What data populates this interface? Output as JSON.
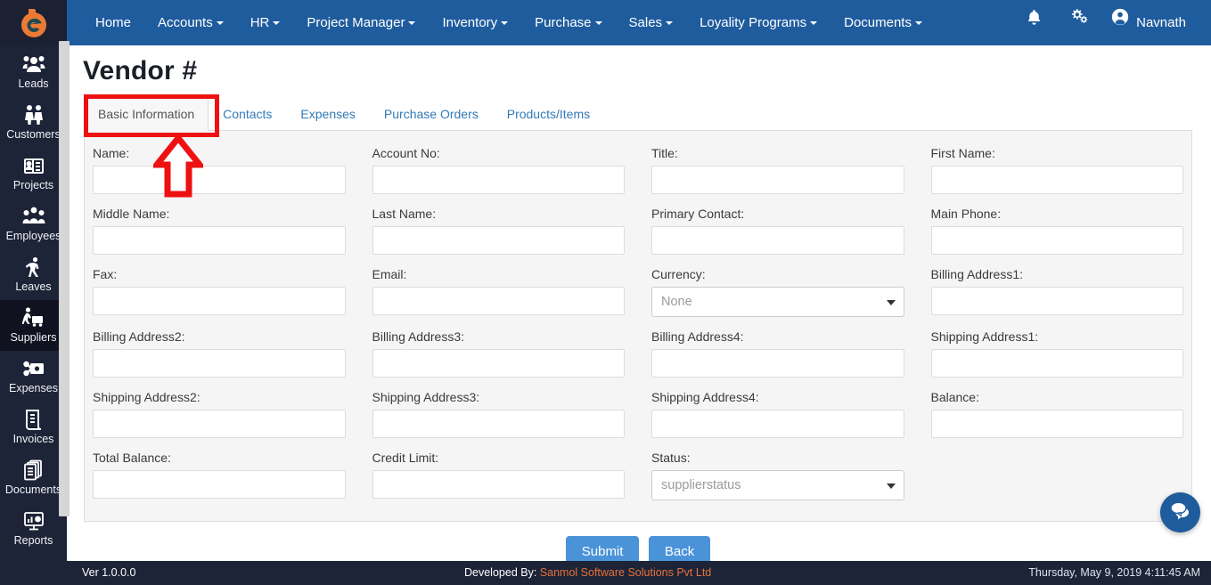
{
  "brand": {
    "logo_icon": "logo-icon",
    "accent_blue": "#1f5c9e",
    "sidebar_bg": "#1d2438",
    "link_blue": "#337ab7",
    "annotation_red": "#ee1111",
    "footer_orange": "#e8703a"
  },
  "navbar": {
    "items": [
      {
        "label": "Home",
        "has_caret": false
      },
      {
        "label": "Accounts",
        "has_caret": true
      },
      {
        "label": "HR",
        "has_caret": true
      },
      {
        "label": "Project Manager",
        "has_caret": true
      },
      {
        "label": "Inventory",
        "has_caret": true
      },
      {
        "label": "Purchase",
        "has_caret": true
      },
      {
        "label": "Sales",
        "has_caret": true
      },
      {
        "label": "Loyality Programs",
        "has_caret": true
      },
      {
        "label": "Documents",
        "has_caret": true
      }
    ],
    "notification_icon": "bell-icon",
    "settings_icon": "gears-icon",
    "user_icon": "user-circle-icon",
    "user_name": "Navnath"
  },
  "sidebar": {
    "items": [
      {
        "label": "Leads",
        "icon": "leads-icon",
        "active": false
      },
      {
        "label": "Customers",
        "icon": "customers-icon",
        "active": false
      },
      {
        "label": "Projects",
        "icon": "projects-icon",
        "active": false
      },
      {
        "label": "Employees",
        "icon": "employees-icon",
        "active": false
      },
      {
        "label": "Leaves",
        "icon": "leaves-icon",
        "active": false
      },
      {
        "label": "Suppliers",
        "icon": "suppliers-icon",
        "active": true
      },
      {
        "label": "Expenses",
        "icon": "expenses-icon",
        "active": false
      },
      {
        "label": "Invoices",
        "icon": "invoices-icon",
        "active": false
      },
      {
        "label": "Documents",
        "icon": "documents-icon",
        "active": false
      },
      {
        "label": "Reports",
        "icon": "reports-icon",
        "active": false
      }
    ]
  },
  "page": {
    "title": "Vendor #"
  },
  "tabs": [
    {
      "label": "Basic Information",
      "active": true
    },
    {
      "label": "Contacts",
      "active": false
    },
    {
      "label": "Expenses",
      "active": false
    },
    {
      "label": "Purchase Orders",
      "active": false
    },
    {
      "label": "Products/Items",
      "active": false
    }
  ],
  "form": {
    "fields": [
      {
        "label": "Name:",
        "type": "text",
        "value": "",
        "placeholder": ""
      },
      {
        "label": "Account No:",
        "type": "text",
        "value": "",
        "placeholder": ""
      },
      {
        "label": "Title:",
        "type": "text",
        "value": "",
        "placeholder": ""
      },
      {
        "label": "First Name:",
        "type": "text",
        "value": "",
        "placeholder": ""
      },
      {
        "label": "Middle Name:",
        "type": "text",
        "value": "",
        "placeholder": ""
      },
      {
        "label": "Last Name:",
        "type": "text",
        "value": "",
        "placeholder": ""
      },
      {
        "label": "Primary Contact:",
        "type": "text",
        "value": "",
        "placeholder": ""
      },
      {
        "label": "Main Phone:",
        "type": "text",
        "value": "",
        "placeholder": ""
      },
      {
        "label": "Fax:",
        "type": "text",
        "value": "",
        "placeholder": ""
      },
      {
        "label": "Email:",
        "type": "text",
        "value": "",
        "placeholder": ""
      },
      {
        "label": "Currency:",
        "type": "select",
        "value": "None",
        "options": [
          "None"
        ]
      },
      {
        "label": "Billing Address1:",
        "type": "text",
        "value": "",
        "placeholder": ""
      },
      {
        "label": "Billing Address2:",
        "type": "text",
        "value": "",
        "placeholder": ""
      },
      {
        "label": "Billing Address3:",
        "type": "text",
        "value": "",
        "placeholder": ""
      },
      {
        "label": "Billing Address4:",
        "type": "text",
        "value": "",
        "placeholder": ""
      },
      {
        "label": "Shipping Address1:",
        "type": "text",
        "value": "",
        "placeholder": ""
      },
      {
        "label": "Shipping Address2:",
        "type": "text",
        "value": "",
        "placeholder": ""
      },
      {
        "label": "Shipping Address3:",
        "type": "text",
        "value": "",
        "placeholder": ""
      },
      {
        "label": "Shipping Address4:",
        "type": "text",
        "value": "",
        "placeholder": ""
      },
      {
        "label": "Balance:",
        "type": "text",
        "value": "",
        "placeholder": ""
      },
      {
        "label": "Total Balance:",
        "type": "text",
        "value": "",
        "placeholder": ""
      },
      {
        "label": "Credit Limit:",
        "type": "text",
        "value": "",
        "placeholder": ""
      },
      {
        "label": "Status:",
        "type": "select",
        "value": "supplierstatus",
        "options": [
          "supplierstatus"
        ]
      }
    ]
  },
  "actions": {
    "submit_label": "Submit",
    "back_label": "Back"
  },
  "chat": {
    "icon": "chat-bubbles-icon"
  },
  "footer": {
    "version": "Ver 1.0.0.0",
    "developed_by_label": "Developed By:",
    "company": "Sanmol Software Solutions Pvt Ltd",
    "datetime": "Thursday, May 9, 2019 4:11:45 AM"
  },
  "annotations": {
    "highlight_target": "Basic Information",
    "shapes": [
      "red-rectangle",
      "red-up-arrow"
    ]
  }
}
